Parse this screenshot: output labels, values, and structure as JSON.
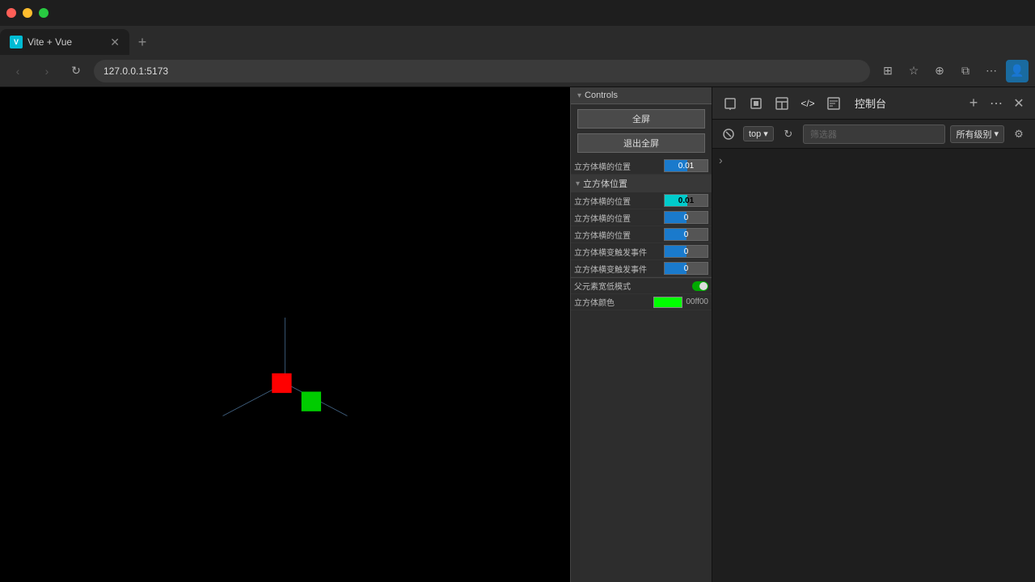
{
  "browser": {
    "tab_title": "Vite + Vue",
    "favicon_text": "V",
    "address": "127.0.0.1:5173",
    "new_tab_icon": "+",
    "nav": {
      "back": "‹",
      "forward": "›",
      "refresh": "↻"
    }
  },
  "controls_panel": {
    "title": "Controls",
    "collapse_icon": "▾",
    "fullscreen_btn": "全屏",
    "exit_fullscreen_btn": "退出全屏",
    "sections": [
      {
        "label": "立方体位置",
        "rows": [
          {
            "label": "立方体横的位置",
            "value": "0.01",
            "fill_pct": 52
          }
        ]
      },
      {
        "label": "立方体位置",
        "rows": [
          {
            "label": "立方体横的位置",
            "value": "0.01",
            "fill_pct": 52
          },
          {
            "label": "立方体横的位置",
            "value": "0",
            "fill_pct": 50
          },
          {
            "label": "立方体横的位置",
            "value": "0",
            "fill_pct": 50
          },
          {
            "label": "立方体横变触发事件",
            "value": "0",
            "fill_pct": 50
          },
          {
            "label": "立方体横变触发事件",
            "value": "0",
            "fill_pct": 50
          }
        ]
      }
    ],
    "toggle_label": "父元素宽低模式",
    "toggle_state": "on",
    "color_label": "立方体颜色",
    "color_value": "#00ff00",
    "color_hex_display": "00ff00"
  },
  "devtools": {
    "icons": {
      "inspect": "⬚",
      "select": "⊡",
      "layout": "▣",
      "code": "</>",
      "console_icon": "▦"
    },
    "title": "控制台",
    "add_icon": "+",
    "more_icon": "⋯",
    "close_icon": "✕",
    "sub_toolbar": {
      "circle_icon": "⊘",
      "top_label": "top",
      "dropdown_icon": "▾",
      "refresh_icon": "↻",
      "search_placeholder": "筛选器",
      "filter_label": "所有级别",
      "filter_dropdown": "▾",
      "settings_icon": "⚙"
    },
    "expand_arrow": "›"
  },
  "scene": {
    "axis_color_x": "#4488ff",
    "axis_color_y": "#4488ff",
    "axis_color_z": "#4488ff",
    "cube1_color": "#ff0000",
    "cube2_color": "#00ff00"
  }
}
